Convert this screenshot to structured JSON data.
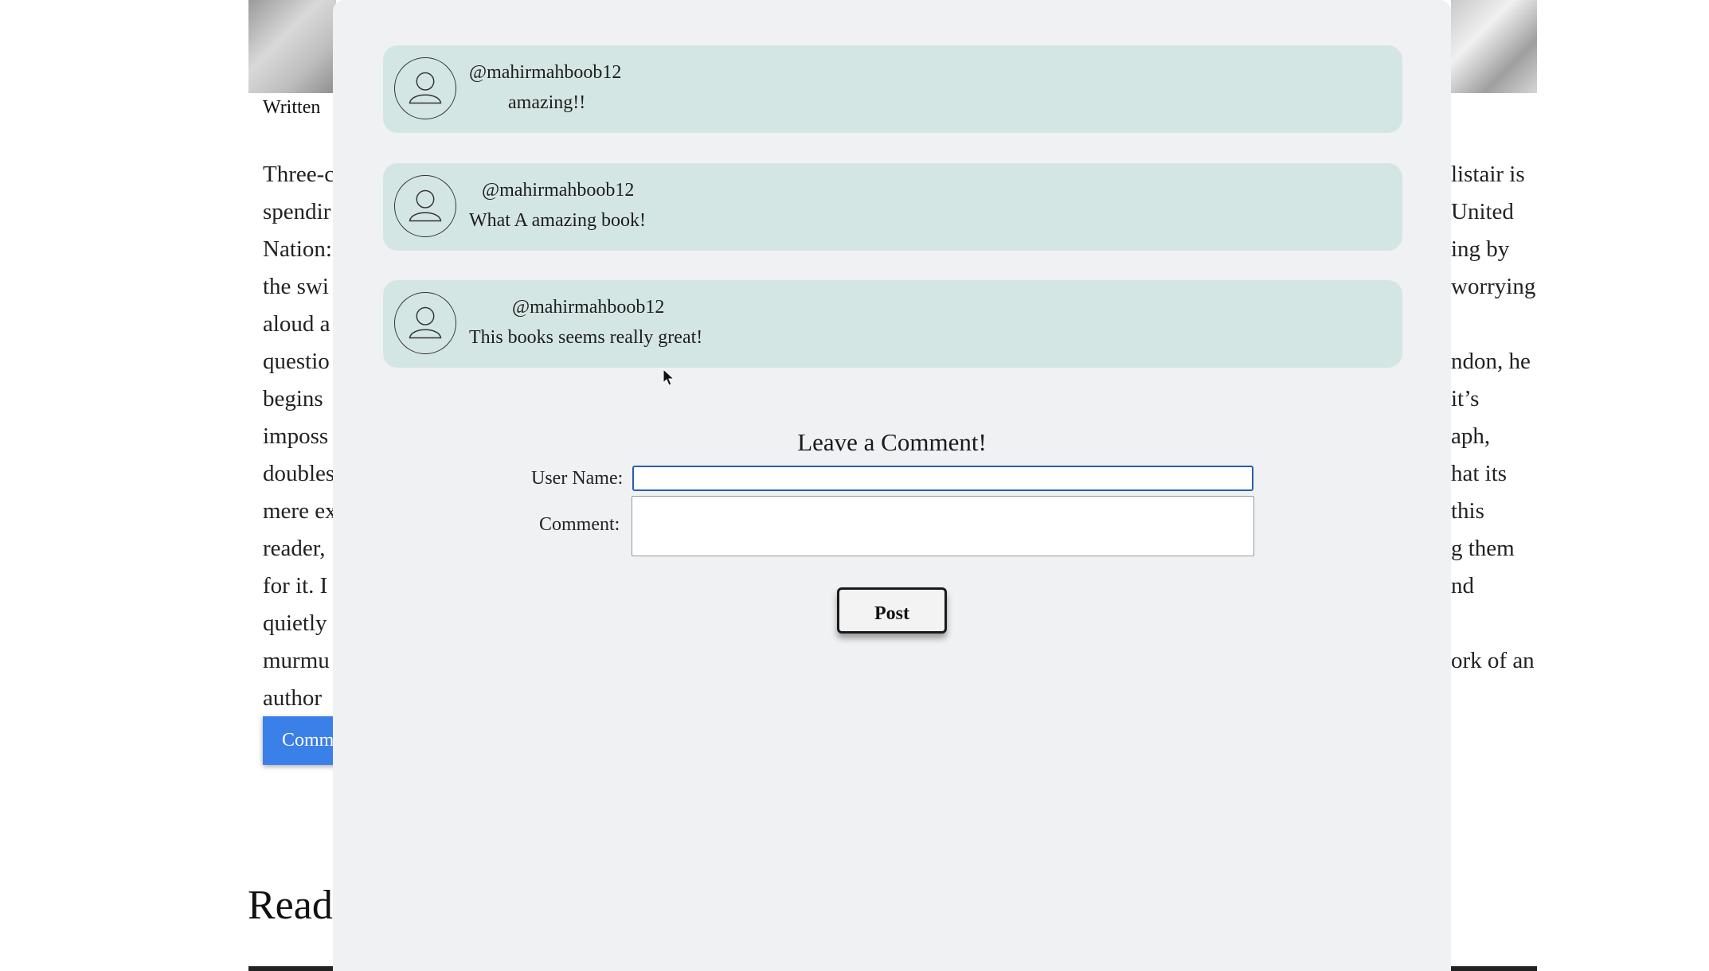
{
  "article": {
    "byline": "Written",
    "left_lines": [
      "Three-c",
      "spendir",
      "Nation:",
      "the swi",
      "aloud a",
      "questio",
      "begins",
      "imposs",
      "doubles",
      "mere ex",
      "reader,",
      "for it. I",
      "quietly",
      "murmu",
      "author"
    ],
    "right_lines": [
      "listair is",
      "United",
      "ing by",
      "worrying",
      "",
      "ndon, he",
      "it’s",
      "aph,",
      "hat its",
      "this",
      "g them",
      "nd",
      "",
      "ork of an",
      ""
    ],
    "comment_button_label": "Comm",
    "read_heading": "Read"
  },
  "comments": [
    {
      "user": "@mahirmahboob12",
      "text": "amazing!!"
    },
    {
      "user": "@mahirmahboob12",
      "text": "What A amazing book!"
    },
    {
      "user": "@mahirmahboob12",
      "text": "This books seems really great!"
    }
  ],
  "form": {
    "title": "Leave a Comment!",
    "username_label": "User Name:",
    "username_value": "",
    "comment_label": "Comment:",
    "comment_value": "",
    "post_label": "Post"
  },
  "colors": {
    "modal_bg": "#eff1f3",
    "card_bg": "#d4e6e3",
    "accent_blue": "#3b7fe8",
    "focus_border": "#2a5db0"
  }
}
